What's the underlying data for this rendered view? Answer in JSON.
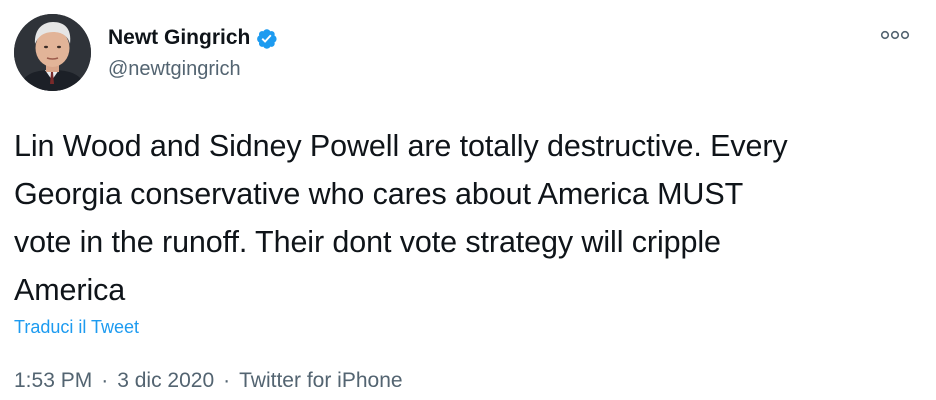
{
  "author": {
    "display_name": "Newt Gingrich",
    "handle": "@newtgingrich",
    "verified": true,
    "verified_color": "#1d9bf0"
  },
  "tweet": {
    "text": "Lin Wood and Sidney Powell are totally destructive. Every\nGeorgia conservative who cares about America MUST\nvote in the runoff. Their dont vote strategy will cripple\nAmerica",
    "translate_label": "Traduci il Tweet"
  },
  "meta": {
    "time": "1:53 PM",
    "separator": "·",
    "date": "3 dic 2020",
    "source": "Twitter for iPhone"
  },
  "icons": {
    "more": "more-options-icon",
    "verified": "verified-badge-icon"
  },
  "colors": {
    "text": "#0f1419",
    "secondary": "#536471",
    "link": "#1d9bf0"
  }
}
